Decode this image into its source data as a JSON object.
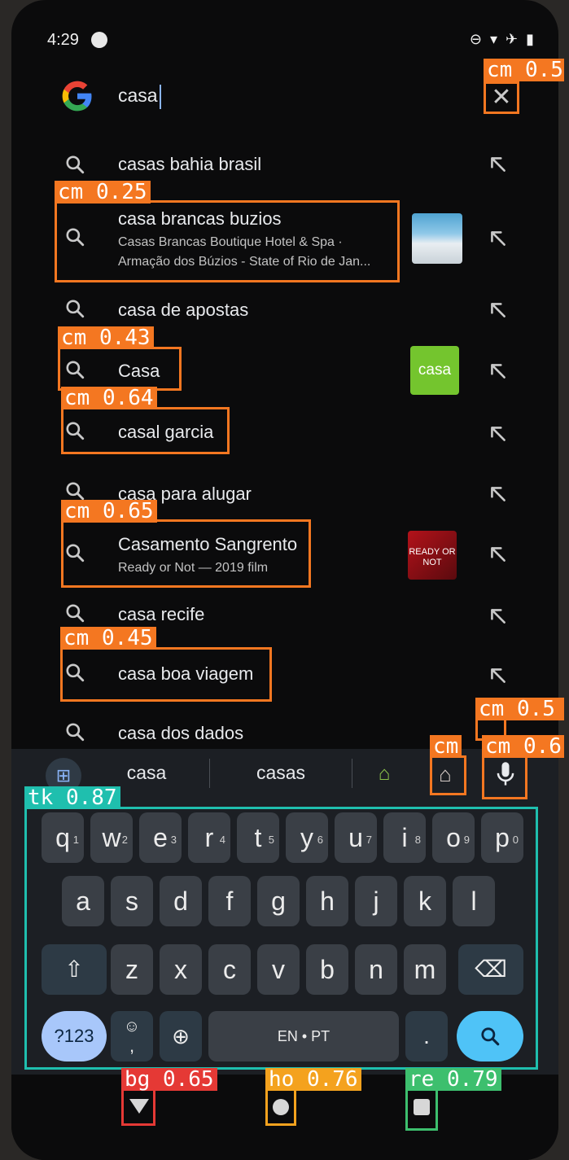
{
  "status_bar": {
    "time": "4:29"
  },
  "search": {
    "query": "casa"
  },
  "suggestions": [
    {
      "text": "casas bahia brasil"
    },
    {
      "text": "casa brancas buzios",
      "sub1": "Casas Brancas Boutique Hotel & Spa ·",
      "sub2": "Armação dos Búzios - State of Rio de Jan..."
    },
    {
      "text": "casa de apostas"
    },
    {
      "text": "Casa",
      "thumb_text": "casa"
    },
    {
      "text": "casal garcia"
    },
    {
      "text": "casa para alugar"
    },
    {
      "text": "Casamento Sangrento",
      "sub1": "Ready or Not — 2019 film",
      "thumb_text": "READY OR NOT"
    },
    {
      "text": "casa recife"
    },
    {
      "text": "casa boa viagem"
    },
    {
      "text": "casa dos dados"
    }
  ],
  "keyboard": {
    "suggestions": [
      "casa",
      "casas"
    ],
    "row1": [
      "q",
      "w",
      "e",
      "r",
      "t",
      "y",
      "u",
      "i",
      "o",
      "p"
    ],
    "row1_hints": [
      "1",
      "2",
      "3",
      "4",
      "5",
      "6",
      "7",
      "8",
      "9",
      "0"
    ],
    "row2": [
      "a",
      "s",
      "d",
      "f",
      "g",
      "h",
      "j",
      "k",
      "l"
    ],
    "row3": [
      "z",
      "x",
      "c",
      "v",
      "b",
      "n",
      "m"
    ],
    "symbols_label": "?123",
    "emoji_label": "☺",
    "comma_label": ",",
    "space_label": "EN • PT",
    "period_label": "."
  },
  "detections": [
    {
      "label": "cm 0.5"
    },
    {
      "label": "cm 0.25"
    },
    {
      "label": "cm 0.43"
    },
    {
      "label": "cm 0.64"
    },
    {
      "label": "cm 0.65"
    },
    {
      "label": "cm 0.45"
    },
    {
      "label": "cm 0.5"
    },
    {
      "label": "cm"
    },
    {
      "label": "cm 0.6"
    },
    {
      "label": "tk 0.87"
    },
    {
      "label": "bg 0.65"
    },
    {
      "label": "ho 0.76"
    },
    {
      "label": "re 0.79"
    }
  ],
  "colors": {
    "accent": "#8ab4f8",
    "detection_orange": "#f47721",
    "detection_teal": "#1fbfae"
  }
}
